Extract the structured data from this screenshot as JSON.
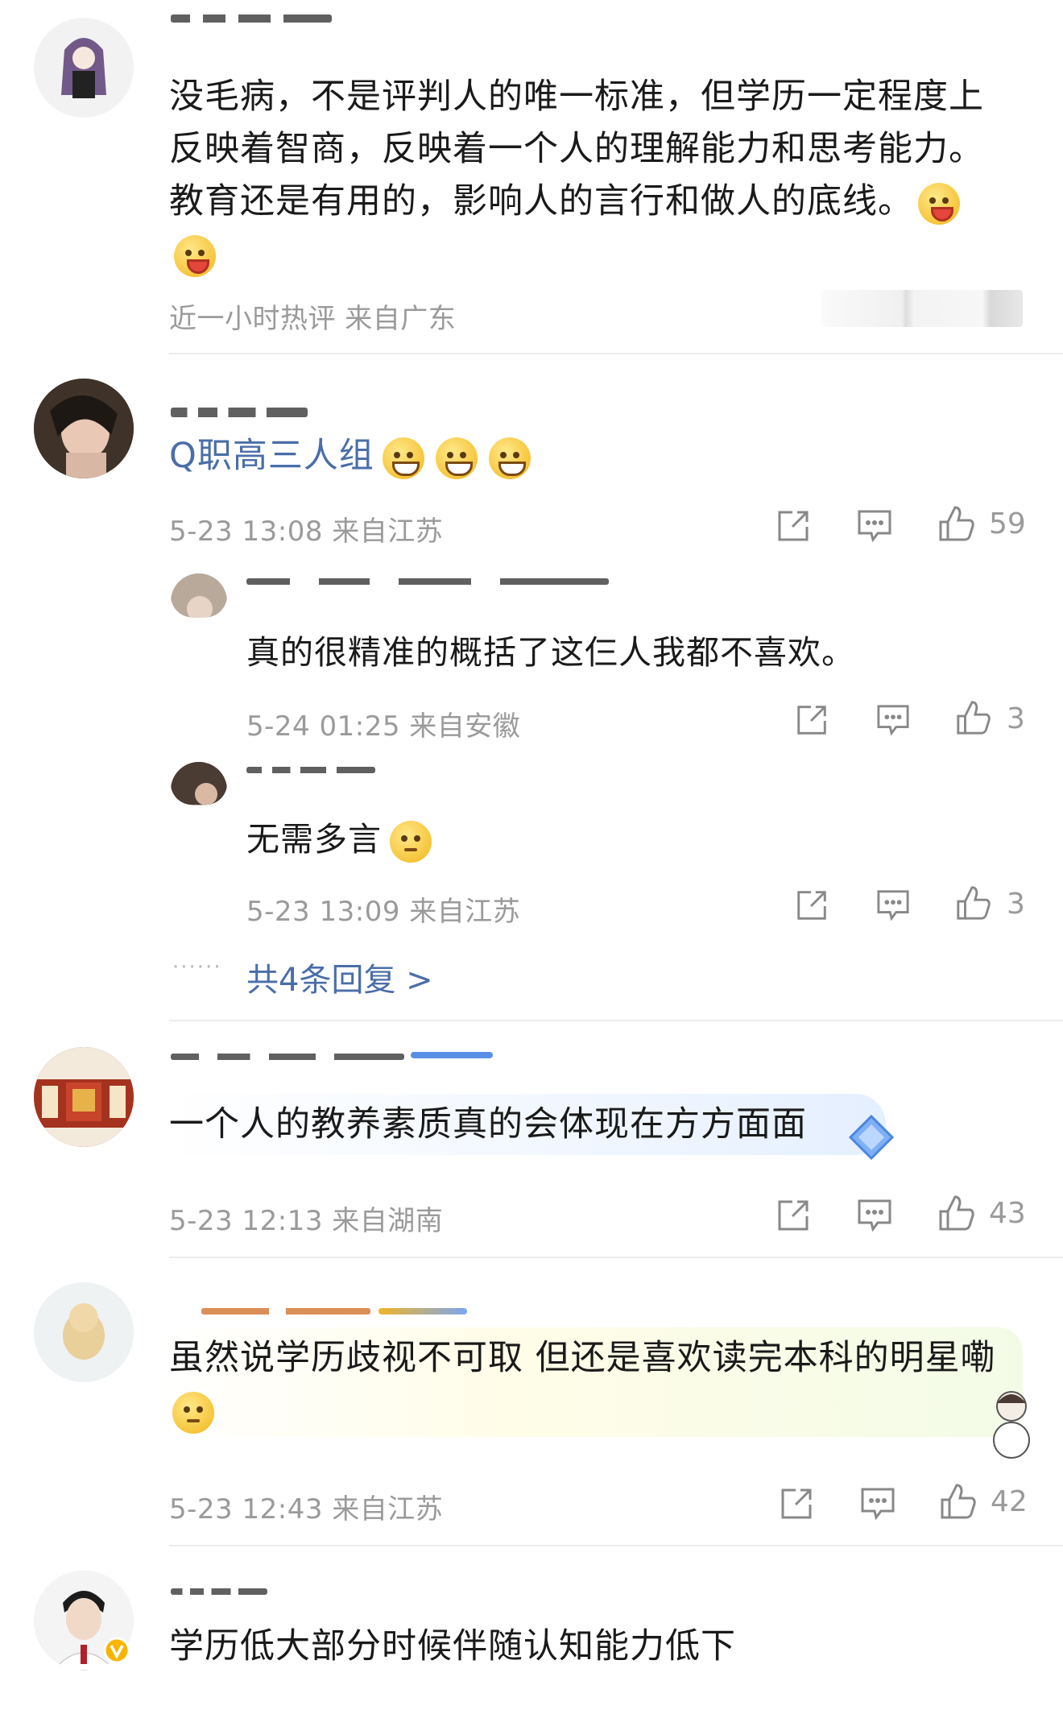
{
  "comments": [
    {
      "text_lines": [
        "没毛病，不是评判人的唯一标准，但学历一定程度上",
        "反映着智商，反映着一个人的理解能力和思考能力。",
        "教育还是有用的，影响人的言行和做人的底线。"
      ],
      "meta": "近一小时热评  来自广东"
    },
    {
      "text_prefix": "Q职高三人组",
      "meta": "5-23 13:08  来自江苏",
      "likes": "59",
      "replies": [
        {
          "text": "真的很精准的概括了这仨人我都不喜欢。",
          "meta": "5-24 01:25  来自安徽",
          "likes": "3"
        },
        {
          "text": "无需多言",
          "meta": "5-23 13:09  来自江苏",
          "likes": "3"
        }
      ],
      "more_replies": "共4条回复 >"
    },
    {
      "text": "一个人的教养素质真的会体现在方方面面",
      "meta": "5-23 12:13  来自湖南",
      "likes": "43"
    },
    {
      "text_lines": [
        "虽然说学历歧视不可取 但还是喜欢读完本科的明星嘞"
      ],
      "meta": "5-23 12:43  来自江苏",
      "likes": "42"
    },
    {
      "text": "学历低大部分时候伴随认知能力低下"
    }
  ],
  "colors": {
    "link": "#4a6ea8",
    "meta": "#9a9a9a",
    "divider": "#ececec"
  },
  "icons": [
    "share-icon",
    "comment-icon",
    "like-icon",
    "verified-badge-icon",
    "super-topic-badge-icon"
  ]
}
